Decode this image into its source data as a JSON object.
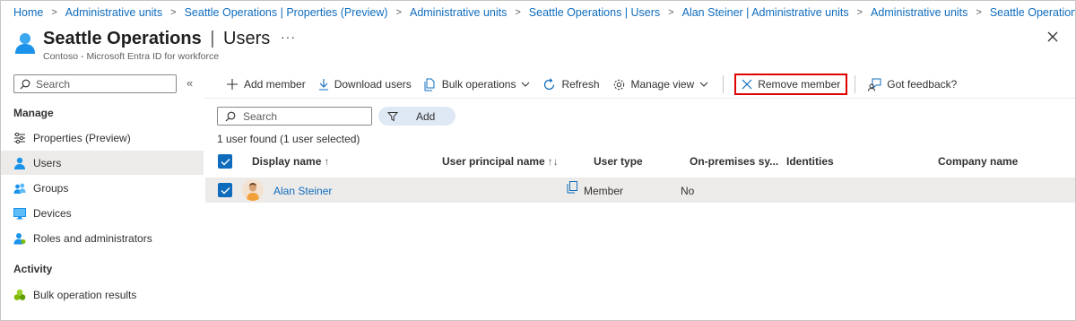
{
  "breadcrumb": [
    "Home",
    "Administrative units",
    "Seattle Operations | Properties (Preview)",
    "Administrative units",
    "Seattle Operations | Users",
    "Alan Steiner | Administrative units",
    "Administrative units",
    "Seattle Operations"
  ],
  "header": {
    "title_name": "Seattle Operations",
    "title_divider": "|",
    "title_section": "Users",
    "more": "···",
    "subtitle": "Contoso - Microsoft Entra ID for workforce",
    "icon": "user-icon",
    "close_icon": "close-icon"
  },
  "sidebar": {
    "search_placeholder": "Search",
    "collapse": "«",
    "manage_label": "Manage",
    "activity_label": "Activity",
    "items": [
      {
        "label": "Properties (Preview)",
        "icon": "sliders-icon"
      },
      {
        "label": "Users",
        "icon": "user-icon",
        "selected": true
      },
      {
        "label": "Groups",
        "icon": "group-icon"
      },
      {
        "label": "Devices",
        "icon": "monitor-icon"
      },
      {
        "label": "Roles and administrators",
        "icon": "role-icon"
      }
    ],
    "activity_items": [
      {
        "label": "Bulk operation results",
        "icon": "bulk-results-icon"
      }
    ]
  },
  "toolbar": {
    "add_member": "Add member",
    "download_users": "Download users",
    "bulk_operations": "Bulk operations",
    "refresh": "Refresh",
    "manage_view": "Manage view",
    "remove_member": "Remove member",
    "feedback": "Got feedback?"
  },
  "filter": {
    "search_placeholder": "Search",
    "add_label": "Add"
  },
  "result_count": "1 user found (1 user selected)",
  "table": {
    "columns": [
      {
        "label": "Display name",
        "sort": "↑"
      },
      {
        "label": "User principal name",
        "sort": "↑↓"
      },
      {
        "label": "User type",
        "sort": ""
      },
      {
        "label": "On-premises sy...",
        "sort": ""
      },
      {
        "label": "Identities",
        "sort": ""
      },
      {
        "label": "Company name",
        "sort": ""
      }
    ],
    "rows": [
      {
        "display_name": "Alan Steiner",
        "user_principal_name": "",
        "user_type": "Member",
        "on_premises_sync": "No",
        "identities": "",
        "company_name": "",
        "selected": true
      }
    ]
  },
  "colors": {
    "accent": "#0f6cbd",
    "highlight": "#e00000",
    "selected_row": "#edebe9",
    "filter_pill": "#dfe9f6"
  }
}
